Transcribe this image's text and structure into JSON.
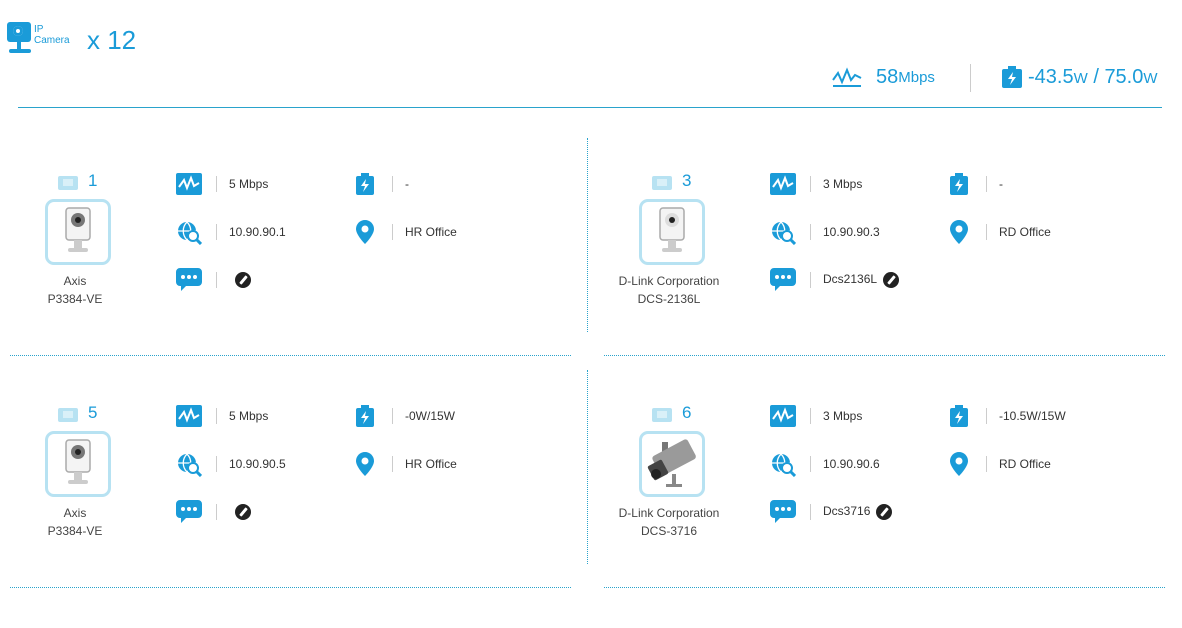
{
  "header": {
    "logo_ip": "IP",
    "logo_camera": "Camera",
    "count": "x 12",
    "bandwidth_value": "58",
    "bandwidth_unit": "Mbps",
    "power_value": "-43.5",
    "power_unit1": "W",
    "power_sep": " / ",
    "power_total": "75.0",
    "power_unit2": "W"
  },
  "colors": {
    "accent": "#1a9bd8",
    "icon_bg": "#b7e2f2",
    "divider": "#2aa3cc"
  },
  "cards": [
    {
      "port": "1",
      "name_line1": "Axis",
      "name_line2": "P3384-VE",
      "device_type": "cube",
      "bandwidth": "5 Mbps",
      "power": "-",
      "ip": "10.90.90.1",
      "location": "HR Office",
      "description": ""
    },
    {
      "port": "3",
      "name_line1": "D-Link Corporation",
      "name_line2": "DCS-2136L",
      "device_type": "cube-white",
      "bandwidth": "3 Mbps",
      "power": "-",
      "ip": "10.90.90.3",
      "location": "RD Office",
      "description": "Dcs2136L"
    },
    {
      "port": "5",
      "name_line1": "Axis",
      "name_line2": "P3384-VE",
      "device_type": "cube",
      "bandwidth": "5 Mbps",
      "power": "-0W/15W",
      "ip": "10.90.90.5",
      "location": "HR Office",
      "description": ""
    },
    {
      "port": "6",
      "name_line1": "D-Link Corporation",
      "name_line2": "DCS-3716",
      "device_type": "bullet",
      "bandwidth": "3 Mbps",
      "power": "-10.5W/15W",
      "ip": "10.90.90.6",
      "location": "RD Office",
      "description": "Dcs3716"
    }
  ],
  "icons": {
    "bandwidth": "bandwidth-icon",
    "power": "battery-bolt-icon",
    "ip": "globe-search-icon",
    "location": "location-pin-icon",
    "description": "chat-bubble-icon",
    "edit": "pencil-icon"
  }
}
